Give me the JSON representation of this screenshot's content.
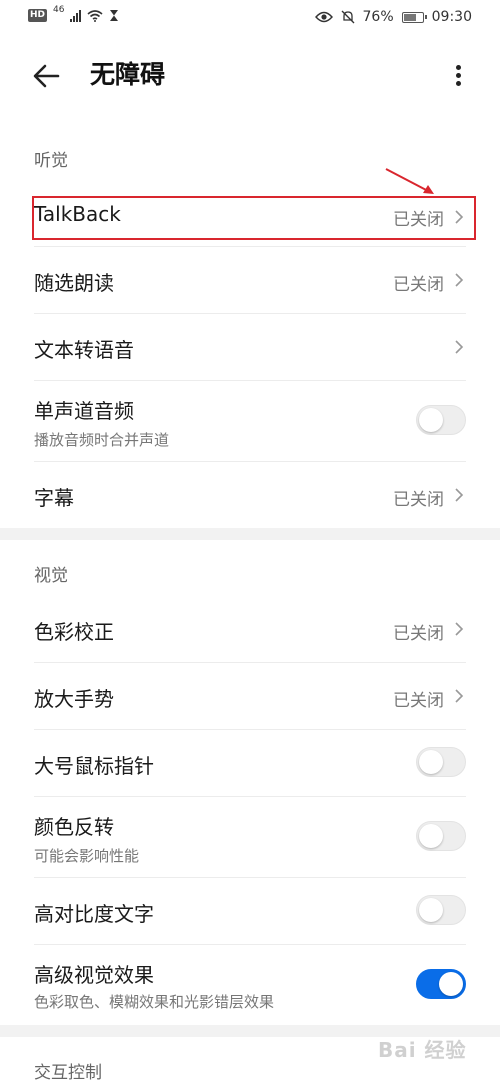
{
  "status_bar": {
    "hd": "HD",
    "network": "46",
    "battery_percent": "76%",
    "battery_level": 0.76,
    "time": "09:30",
    "icons": [
      "signal-icon",
      "wifi-icon",
      "hourglass-icon",
      "eye-icon",
      "mute-bell-icon",
      "battery-icon"
    ]
  },
  "header": {
    "title": "无障碍",
    "back_icon": "arrow-left-icon",
    "more_icon": "more-vertical-icon"
  },
  "sections": {
    "hearing": {
      "label": "听觉",
      "items": [
        {
          "label": "TalkBack",
          "value": "已关闭"
        },
        {
          "label": "随选朗读",
          "value": "已关闭"
        },
        {
          "label": "文本转语音"
        },
        {
          "label": "单声道音频",
          "sub": "播放音频时合并声道",
          "toggle": false
        },
        {
          "label": "字幕",
          "value": "已关闭"
        }
      ]
    },
    "vision": {
      "label": "视觉",
      "items": [
        {
          "label": "色彩校正",
          "value": "已关闭"
        },
        {
          "label": "放大手势",
          "value": "已关闭"
        },
        {
          "label": "大号鼠标指针",
          "toggle": false
        },
        {
          "label": "颜色反转",
          "sub": "可能会影响性能",
          "toggle": false
        },
        {
          "label": "高对比度文字",
          "toggle": false
        },
        {
          "label": "高级视觉效果",
          "sub": "色彩取色、模糊效果和光影错层效果",
          "toggle": true
        }
      ]
    },
    "interaction": {
      "label": "交互控制"
    }
  },
  "annotation": {
    "highlight_color": "#d9262e",
    "target": "TalkBack"
  },
  "watermark": "Bai 经验",
  "accent_color": "#0a6de8"
}
